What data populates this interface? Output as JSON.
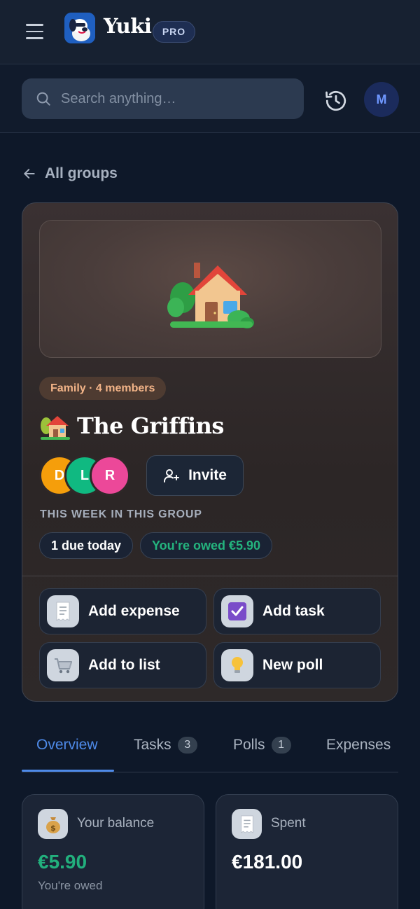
{
  "app": {
    "name": "Yuki",
    "plan_badge": "PRO"
  },
  "search": {
    "placeholder": "Search anything…",
    "value": ""
  },
  "user": {
    "initial": "M"
  },
  "nav": {
    "back_label": "All groups"
  },
  "group": {
    "tag": "Family · 4 members",
    "title": "The Griffins",
    "members": [
      {
        "initial": "D",
        "color": "#f59e0b"
      },
      {
        "initial": "L",
        "color": "#10b981"
      },
      {
        "initial": "R",
        "color": "#ec4899"
      }
    ],
    "invite_label": "Invite",
    "week_label": "THIS WEEK IN THIS GROUP",
    "chips": {
      "due": "1 due today",
      "owed": "You're owed €5.90"
    },
    "actions": [
      {
        "label": "Add expense",
        "icon": "receipt-icon"
      },
      {
        "label": "Add task",
        "icon": "checkbox-icon"
      },
      {
        "label": "Add to list",
        "icon": "cart-icon"
      },
      {
        "label": "New poll",
        "icon": "lightbulb-icon"
      }
    ]
  },
  "tabs": [
    {
      "label": "Overview",
      "count": null,
      "active": true
    },
    {
      "label": "Tasks",
      "count": "3",
      "active": false
    },
    {
      "label": "Polls",
      "count": "1",
      "active": false
    },
    {
      "label": "Expenses",
      "count": null,
      "active": false
    }
  ],
  "stats": {
    "balance": {
      "label": "Your balance",
      "value": "€5.90",
      "sub": "You're owed",
      "color": "#22b07d"
    },
    "spent": {
      "label": "Spent",
      "value": "€181.00",
      "color": "#ffffff"
    }
  },
  "colors": {
    "accent": "#4e8ae8",
    "positive": "#24b47e",
    "tag_text": "#f3b488"
  }
}
